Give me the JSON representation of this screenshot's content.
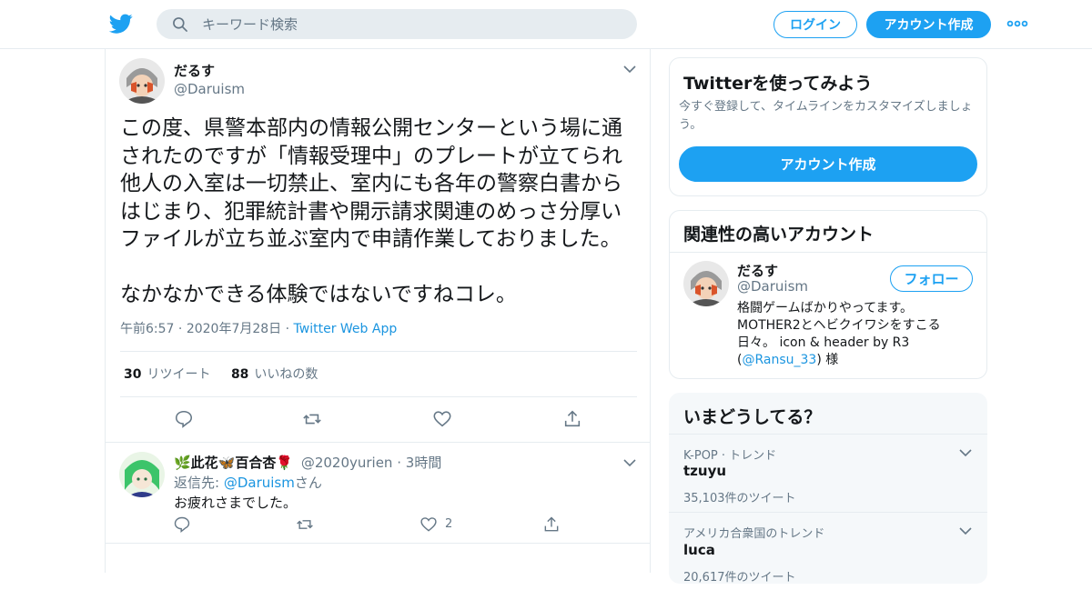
{
  "header": {
    "logo_icon": "twitter-bird-icon",
    "search_placeholder": "キーワード検索",
    "login_label": "ログイン",
    "signup_label": "アカウント作成",
    "more_icon": "more-dots-icon",
    "brand_color": "#1da1f2"
  },
  "tweet": {
    "name": "だるす",
    "handle": "@Daruism",
    "text": "この度、県警本部内の情報公開センターという場に通\nされたのですが「情報受理中」のプレートが立てられ\n他人の入室は一切禁止、室内にも各年の警察白書から\nはじまり、犯罪統計書や開示請求関連のめっさ分厚い\nファイルが立ち並ぶ室内で申請作業しておりました。\n\nなかなかできる体験ではないですねコレ。",
    "time": "午前6:57",
    "date": "2020年7月28日",
    "source": "Twitter Web App",
    "retweets_count": "30",
    "retweets_label": "リツイート",
    "likes_count": "88",
    "likes_label": "いいねの数"
  },
  "reply": {
    "name": "🌿此花🦋百合杏🌹",
    "handle": "@2020yurien",
    "time": "3時間",
    "reply_to_prefix": "返信先: ",
    "reply_to_handle": "@Daruism",
    "reply_to_suffix": "さん",
    "text": "お疲れさまでした。",
    "like_count": "2"
  },
  "signup_card": {
    "title": "Twitterを使ってみよう",
    "subtitle": "今すぐ登録して、タイムラインをカスタマイズしましょう。",
    "button_label": "アカウント作成"
  },
  "related_card": {
    "title": "関連性の高いアカウント",
    "name": "だるす",
    "handle": "@Daruism",
    "follow_label": "フォロー",
    "bio_line1": "格闘ゲームばかりやってます。",
    "bio_line2": "MOTHER2とヘビクイワシをすこる",
    "bio_line3": "日々。 icon & header by R3",
    "bio_open": "(",
    "bio_mention": "@Ransu_33",
    "bio_close": ") 様"
  },
  "trends": {
    "title": "いまどうしてる？",
    "items": [
      {
        "context": "K-POP · トレンド",
        "name": "tzuyu",
        "count": "35,103件のツイート"
      },
      {
        "context": "アメリカ合衆国のトレンド",
        "name": "luca",
        "count": "20,617件のツイート"
      }
    ]
  }
}
